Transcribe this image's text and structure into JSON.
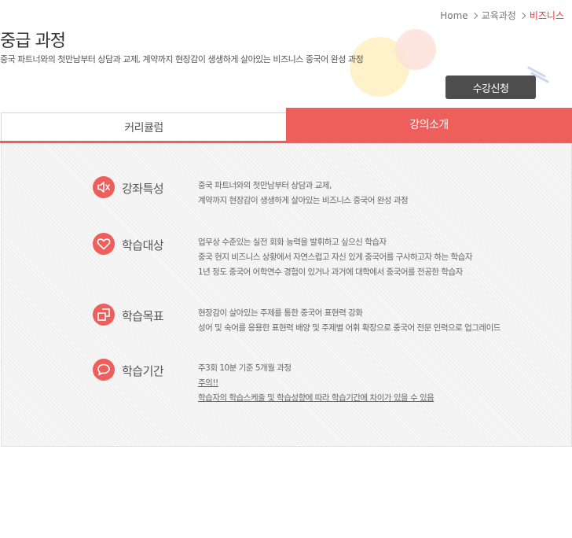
{
  "breadcrumb": {
    "home": "Home",
    "level1": "교육과정",
    "current": "비즈니스"
  },
  "header": {
    "title": "중급 과정",
    "subtitle": "중국 파트너와의 첫만남부터 상담과 교제, 계약까지 현장감이 생생하게 살아있는 비즈니스 중국어 완성 과정",
    "enroll_label": "수강신청"
  },
  "tabs": [
    {
      "label": "커리큘럼",
      "active": false
    },
    {
      "label": "강의소개",
      "active": true
    }
  ],
  "colors": {
    "accent": "#ee5f5c",
    "button": "#4d4d4d",
    "breadcrumb_current": "#e0393b"
  },
  "sections": [
    {
      "icon": "speaker-icon",
      "title": "강좌특성",
      "lines": [
        "중국 파트너와의 첫만남부터 상담과 교제,",
        "계약까지 현장감이 생생하게 살아있는 비즈니스 중국어 완성 과정"
      ]
    },
    {
      "icon": "heart-icon",
      "title": "학습대상",
      "lines": [
        "업무상 수준있는 실전 회화 능력을 발휘하고 싶으신 학습자",
        "중국 현지 비즈니스 상황에서 자연스럽고 자신 있게 중국어를 구사하고자 하는 학습자",
        "1년 정도 중국어 어학연수 경험이 있거나 과거에 대학에서 중국어를 전공한 학습자"
      ]
    },
    {
      "icon": "target-icon",
      "title": "학습목표",
      "lines": [
        "현장감이 살아있는 주제를 통한 중국어 표현력 강화",
        "성어 및 숙어를 응용한 표현력 배양 및 주제별 어휘 확장으로 중국어 전문 인력으로 업그레이드"
      ]
    },
    {
      "icon": "speech-bubble-icon",
      "title": "학습기간",
      "lines": [
        "주3회 10분 기준 5개월 과정",
        "주의!!",
        "학습자의 학습스케줄 및 학습성향에 따라 학습기간에 차이가 있을 수 있음"
      ]
    }
  ]
}
